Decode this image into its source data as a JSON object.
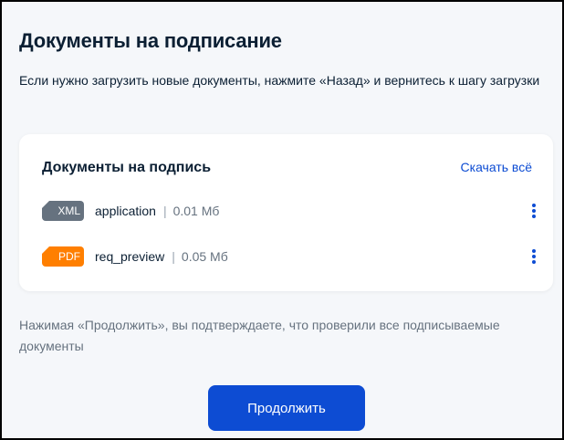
{
  "page": {
    "title": "Документы на подписание",
    "hint": "Если нужно загрузить новые документы, нажмите «Назад» и вернитесь к шагу загрузки"
  },
  "card": {
    "title": "Документы на подпись",
    "download_all": "Скачать всё",
    "documents": [
      {
        "type": "XML",
        "name": "application",
        "separator": "|",
        "size": "0.01 Мб",
        "badge_color": "#66727f",
        "menu_icon": "kebab-menu-icon"
      },
      {
        "type": "PDF",
        "name": "req_preview",
        "separator": "|",
        "size": "0.05 Мб",
        "badge_color": "#ff7f00",
        "menu_icon": "kebab-menu-icon"
      }
    ]
  },
  "footer": {
    "note": "Нажимая «Продолжить», вы подтверждаете, что проверили все подписываемые документы",
    "continue_label": "Продолжить"
  },
  "colors": {
    "accent": "#0d4cd3",
    "background": "#f5f7fa",
    "text": "#0b1f33",
    "muted": "#66727f"
  }
}
